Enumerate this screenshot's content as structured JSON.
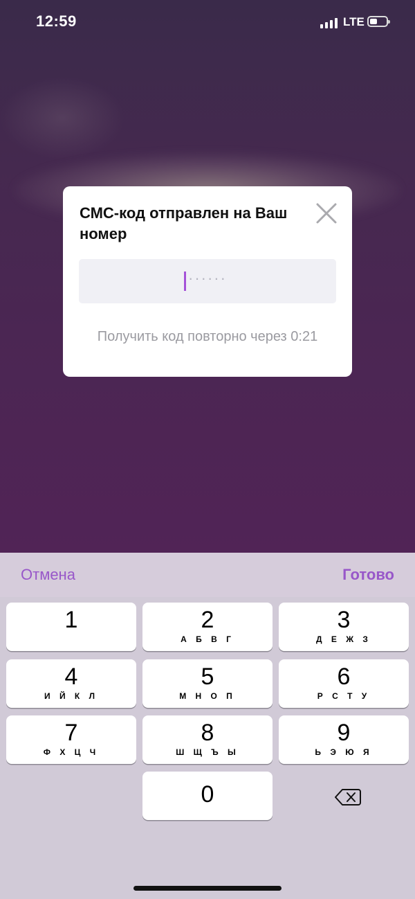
{
  "status_bar": {
    "time": "12:59",
    "network": "LTE",
    "battery_level": 0.45
  },
  "dialog": {
    "title": "СМС-код отправлен на Ваш номер",
    "code_placeholder": "······",
    "resend_text": "Получить код повторно через 0:21",
    "close_icon": "close-icon"
  },
  "keyboard": {
    "cancel_label": "Отмена",
    "done_label": "Готово",
    "keys": [
      {
        "digit": "1",
        "letters": ""
      },
      {
        "digit": "2",
        "letters": "А Б В Г"
      },
      {
        "digit": "3",
        "letters": "Д Е Ж З"
      },
      {
        "digit": "4",
        "letters": "И Й К Л"
      },
      {
        "digit": "5",
        "letters": "М Н О П"
      },
      {
        "digit": "6",
        "letters": "Р С Т У"
      },
      {
        "digit": "7",
        "letters": "Ф Х Ц Ч"
      },
      {
        "digit": "8",
        "letters": "Ш Щ Ъ Ы"
      },
      {
        "digit": "9",
        "letters": "Ь Э Ю Я"
      },
      {
        "digit": "0",
        "letters": ""
      }
    ],
    "delete_icon": "backspace-icon"
  },
  "colors": {
    "accent": "#9857c9",
    "caret": "#a552d8"
  }
}
